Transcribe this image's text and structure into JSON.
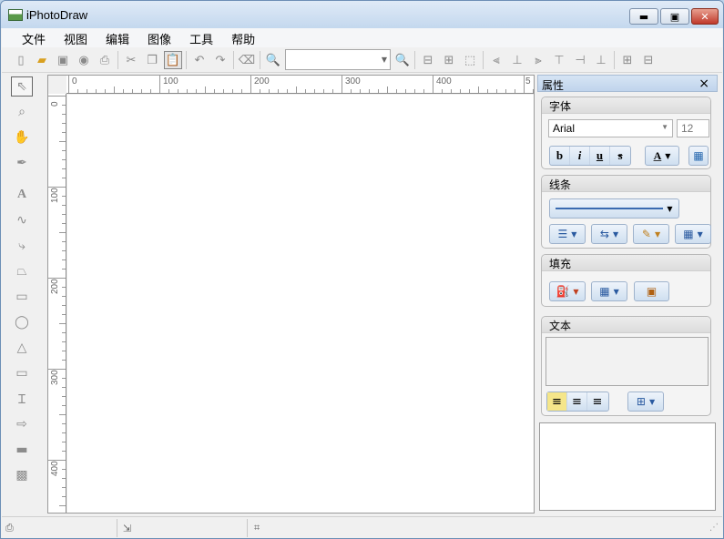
{
  "window": {
    "title": "iPhotoDraw"
  },
  "menu": [
    "文件",
    "视图",
    "编辑",
    "图像",
    "工具",
    "帮助"
  ],
  "toolbar": {
    "icons": [
      "new-icon",
      "open-icon",
      "save-icon",
      "export-icon",
      "print-icon",
      "cut-icon",
      "copy-icon",
      "paste-icon",
      "undo-icon",
      "redo-icon",
      "clear-icon",
      "zoom-out-icon",
      "zoom-in-icon",
      "group-icon",
      "ungroup-icon",
      "select-group-icon",
      "align-left-icon",
      "align-center-icon",
      "align-right-icon",
      "align-top-icon",
      "align-middle-icon",
      "align-bottom-icon",
      "add-icon",
      "remove-icon"
    ],
    "zoom_value": ""
  },
  "left_tools": [
    "select-tool-icon",
    "zoom-tool-icon",
    "pan-tool-icon",
    "pen-tool-icon",
    "text-tool-icon",
    "freehand-tool-icon",
    "connector-tool-icon",
    "polygon-tool-icon",
    "rectangle-tool-icon",
    "ellipse-tool-icon",
    "triangle-tool-icon",
    "callout-tool-icon",
    "highlight-tool-icon",
    "arrow-tool-icon",
    "image-tool-icon",
    "mosaic-tool-icon"
  ],
  "ruler": {
    "h_labels": [
      "0",
      "100",
      "200",
      "300",
      "400",
      "5"
    ],
    "v_labels": [
      "0",
      "100",
      "200",
      "300",
      "400"
    ]
  },
  "properties": {
    "title": "属性",
    "close": "×",
    "font_group": {
      "title": "字体",
      "font_name": "Arial",
      "font_size": "12",
      "bold": "b",
      "italic": "i",
      "underline": "u",
      "strike": "s",
      "color_letter": "A"
    },
    "line_group": {
      "title": "线条"
    },
    "fill_group": {
      "title": "填充"
    },
    "text_group": {
      "title": "文本",
      "text_value": ""
    }
  },
  "statusbar": {
    "left_text": "",
    "mid_text": "",
    "right_text": ""
  }
}
